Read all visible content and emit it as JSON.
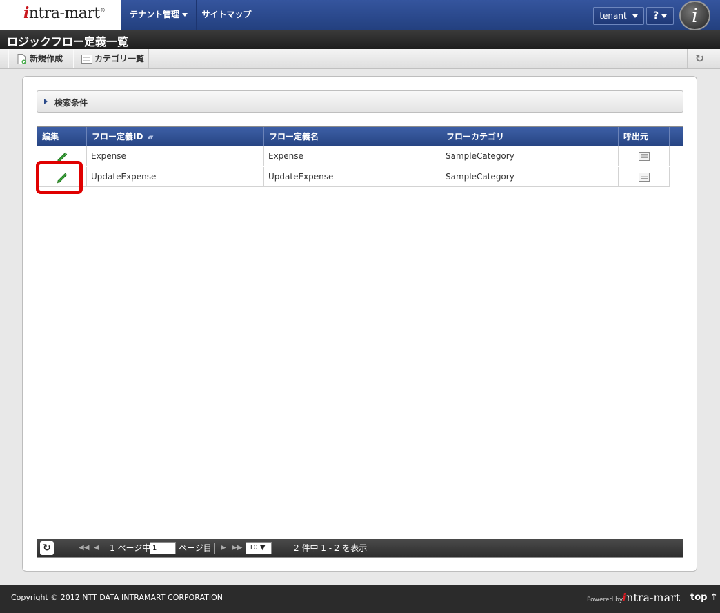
{
  "header": {
    "logo_i": "i",
    "logo_rest": "ntra-mart",
    "logo_reg": "®",
    "nav": [
      {
        "label": "テナント管理"
      },
      {
        "label": "サイトマップ"
      }
    ],
    "user_label": "tenant",
    "help_label": "?",
    "badge_letter": "i"
  },
  "page": {
    "title": "ロジックフロー定義一覧"
  },
  "toolbar": {
    "new_label": "新規作成",
    "category_label": "カテゴリ一覧",
    "refresh_glyph": "↻"
  },
  "search": {
    "label": "検索条件"
  },
  "grid": {
    "columns": [
      "編集",
      "フロー定義ID",
      "フロー定義名",
      "フローカテゴリ",
      "呼出元"
    ],
    "sort_glyph": "▲▼",
    "rows": [
      {
        "id": "Expense",
        "name": "Expense",
        "category": "SampleCategory"
      },
      {
        "id": "UpdateExpense",
        "name": "UpdateExpense",
        "category": "SampleCategory"
      }
    ]
  },
  "pager": {
    "refresh_glyph": "↻",
    "first": "◀◀",
    "prev": "◀",
    "page_prefix": "1 ページ中",
    "page_value": "1",
    "page_suffix": "ページ目",
    "next": "▶",
    "last": "▶▶",
    "per_page": "10 ▼",
    "summary": "2 件中 1 - 2 を表示"
  },
  "footer": {
    "copyright": "Copyright © 2012 NTT DATA INTRAMART CORPORATION",
    "powered": "Powered by",
    "logo_i": "i",
    "logo_rest": "ntra-mart",
    "top_label": "top ↑"
  },
  "colors": {
    "header": "#2b4a8e",
    "highlight": "#e00000",
    "edit_icon": "#3aa23a"
  }
}
